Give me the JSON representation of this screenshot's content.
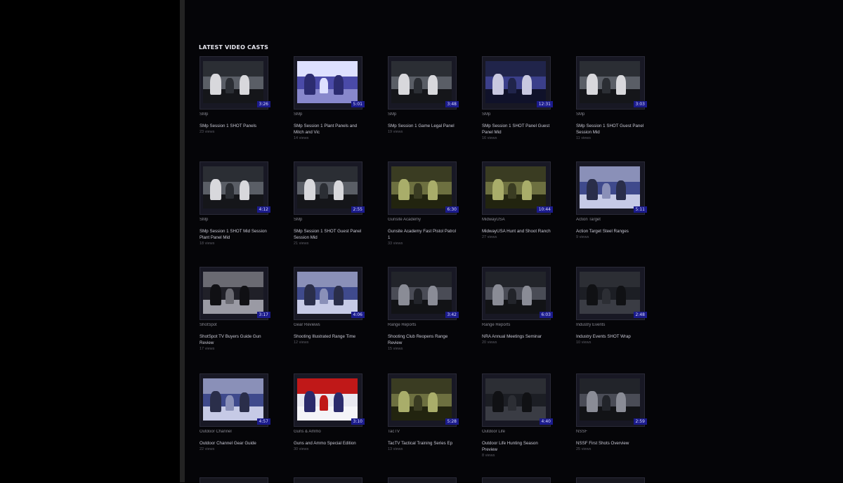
{
  "section": {
    "title": "LATEST VIDEO CASTS"
  },
  "colors": {
    "accent": "#1b1b8c",
    "background": "#000000"
  },
  "videos": [
    {
      "category": "SMp",
      "title": "SMp Session 1 SHOT Panels",
      "views": "23 views",
      "duration": "3:26",
      "thumb": "studio"
    },
    {
      "category": "SMp",
      "title": "SMp Session 1 Plant Panels and Mitch and Vic",
      "views": "14 views",
      "duration": "5:01",
      "thumb": "logo"
    },
    {
      "category": "SMp",
      "title": "SMp Session 1 Game Legal Panel",
      "views": "19 views",
      "duration": "3:48",
      "thumb": "studio"
    },
    {
      "category": "SMp",
      "title": "SMp Session 1 SHOT Panel Guest Panel Mid",
      "views": "16 views",
      "duration": "12:31",
      "thumb": "studio-blue"
    },
    {
      "category": "SMp",
      "title": "SMp Session 1 SHOT Guest Panel Session Mid",
      "views": "11 views",
      "duration": "3:03",
      "thumb": "studio"
    },
    {
      "category": "SMp",
      "title": "SMp Session 1 SHOT Mid Session Plant Panel Mid",
      "views": "18 views",
      "duration": "4:12",
      "thumb": "studio"
    },
    {
      "category": "SMp",
      "title": "SMp Session 1 SHOT Guest Panel Session Mid",
      "views": "21 views",
      "duration": "2:55",
      "thumb": "studio"
    },
    {
      "category": "Gunsite Academy",
      "title": "Gunsite Academy Fast Pistol Patrol 1",
      "views": "33 views",
      "duration": "6:30",
      "thumb": "field"
    },
    {
      "category": "MidwayUSA",
      "title": "MidwayUSA Hunt and Shoot Ranch",
      "views": "27 views",
      "duration": "10:44",
      "thumb": "field"
    },
    {
      "category": "Action Target",
      "title": "Action Target Steel Ranges",
      "views": "9 views",
      "duration": "5:11",
      "thumb": "range"
    },
    {
      "category": "ShotSpot",
      "title": "ShotSpot TV Buyers Guide Gun Review",
      "views": "17 views",
      "duration": "3:17",
      "thumb": "text"
    },
    {
      "category": "Gear Reviews",
      "title": "Shooting Illustrated Range Time",
      "views": "12 views",
      "duration": "4:06",
      "thumb": "range"
    },
    {
      "category": "Range Reports",
      "title": "Shooting Club Reopens Range Review",
      "views": "15 views",
      "duration": "3:42",
      "thumb": "crowd"
    },
    {
      "category": "Range Reports",
      "title": "NRA Annual Meetings Seminar",
      "views": "20 views",
      "duration": "6:03",
      "thumb": "crowd"
    },
    {
      "category": "Industry Events",
      "title": "Industry Events SHOT Wrap",
      "views": "10 views",
      "duration": "2:48",
      "thumb": "dark"
    },
    {
      "category": "Outdoor Channel",
      "title": "Outdoor Channel Gear Guide",
      "views": "22 views",
      "duration": "4:57",
      "thumb": "range"
    },
    {
      "category": "Guns & Ammo",
      "title": "Guns and Ammo Special Edition",
      "views": "30 views",
      "duration": "3:10",
      "thumb": "poster"
    },
    {
      "category": "TacTV",
      "title": "TacTV Tactical Training Series Ep",
      "views": "13 views",
      "duration": "5:28",
      "thumb": "field"
    },
    {
      "category": "Outdoor Life",
      "title": "Outdoor Life Hunting Season Preview",
      "views": "8 views",
      "duration": "4:40",
      "thumb": "dark"
    },
    {
      "category": "NSSF",
      "title": "NSSF First Shots Overview",
      "views": "25 views",
      "duration": "2:59",
      "thumb": "crowd"
    }
  ]
}
